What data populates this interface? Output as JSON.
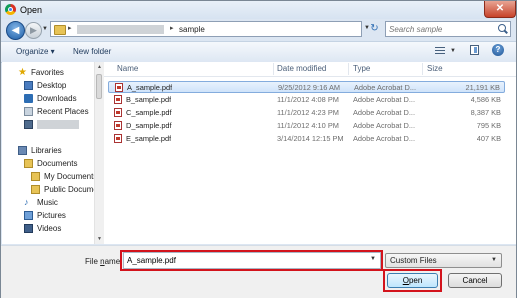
{
  "window": {
    "title": "Open",
    "close_glyph": "✕"
  },
  "nav": {
    "back_glyph": "◀",
    "forward_glyph": "▶",
    "address": {
      "separator": "▸",
      "current": "sample"
    },
    "refresh_glyph": "↻",
    "search_placeholder": "Search sample"
  },
  "toolbar": {
    "organize": "Organize ▾",
    "new_folder": "New folder",
    "help_glyph": "?"
  },
  "sidebar": {
    "favorites": "Favorites",
    "desktop": "Desktop",
    "downloads": "Downloads",
    "recent_places": "Recent Places",
    "libraries": "Libraries",
    "documents": "Documents",
    "my_documents": "My Documents",
    "public_documents": "Public Docume",
    "music": "Music",
    "pictures": "Pictures",
    "videos": "Videos"
  },
  "columns": {
    "name": "Name",
    "date": "Date modified",
    "type": "Type",
    "size": "Size"
  },
  "files": [
    {
      "name": "A_sample.pdf",
      "date": "9/25/2012 9:16 AM",
      "type": "Adobe Acrobat D...",
      "size": "21,191 KB"
    },
    {
      "name": "B_sample.pdf",
      "date": "11/1/2012 4:08 PM",
      "type": "Adobe Acrobat D...",
      "size": "4,586 KB"
    },
    {
      "name": "C_sample.pdf",
      "date": "11/1/2012 4:23 PM",
      "type": "Adobe Acrobat D...",
      "size": "8,387 KB"
    },
    {
      "name": "D_sample.pdf",
      "date": "11/1/2012 4:10 PM",
      "type": "Adobe Acrobat D...",
      "size": "795 KB"
    },
    {
      "name": "E_sample.pdf",
      "date": "3/14/2014 12:15 PM",
      "type": "Adobe Acrobat D...",
      "size": "407 KB"
    }
  ],
  "footer": {
    "file_name_label_pre": "File ",
    "file_name_label_key": "n",
    "file_name_label_post": "ame:",
    "file_name_value": "A_sample.pdf",
    "file_type": "Custom Files",
    "open_key": "O",
    "open_rest": "pen",
    "cancel": "Cancel"
  },
  "colors": {
    "highlight": "#d3131c",
    "selection": "#cfe3fa"
  }
}
